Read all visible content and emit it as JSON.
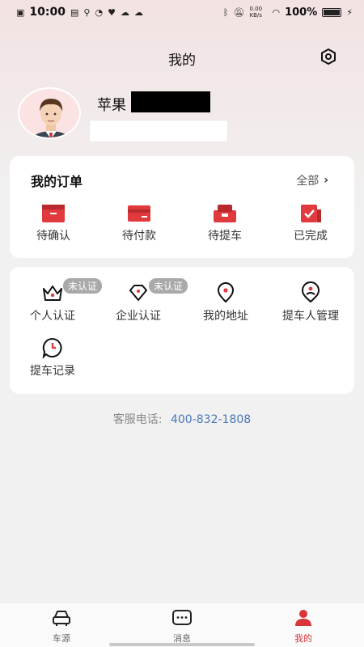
{
  "status_bar": {
    "time": "10:00",
    "net_speed": "0.00 KB/s",
    "battery": "100%"
  },
  "header": {
    "title": "我的",
    "settings_icon": "gear-hex-icon"
  },
  "user": {
    "name": "苹果"
  },
  "orders": {
    "title": "我的订单",
    "all_label": "全部",
    "items": [
      {
        "label": "待确认",
        "icon": "pending-confirm-icon"
      },
      {
        "label": "待付款",
        "icon": "pending-payment-icon"
      },
      {
        "label": "待提车",
        "icon": "pending-pickup-icon"
      },
      {
        "label": "已完成",
        "icon": "completed-icon"
      }
    ]
  },
  "services": {
    "items": [
      {
        "label": "个人认证",
        "badge": "未认证",
        "icon": "crown-icon"
      },
      {
        "label": "企业认证",
        "badge": "未认证",
        "icon": "diamond-icon"
      },
      {
        "label": "我的地址",
        "icon": "location-pin-icon"
      },
      {
        "label": "提车人管理",
        "icon": "person-pin-icon"
      },
      {
        "label": "提车记录",
        "icon": "clock-bubble-icon"
      }
    ]
  },
  "hotline": {
    "label": "客服电话:",
    "number": "400-832-1808"
  },
  "tabbar": {
    "items": [
      {
        "label": "车源",
        "icon": "car-icon"
      },
      {
        "label": "消息",
        "icon": "message-icon"
      },
      {
        "label": "我的",
        "icon": "profile-icon",
        "active": true
      }
    ]
  },
  "colors": {
    "accent": "#d9353a",
    "link": "#4a78b8",
    "badge": "#a9a9a9"
  }
}
